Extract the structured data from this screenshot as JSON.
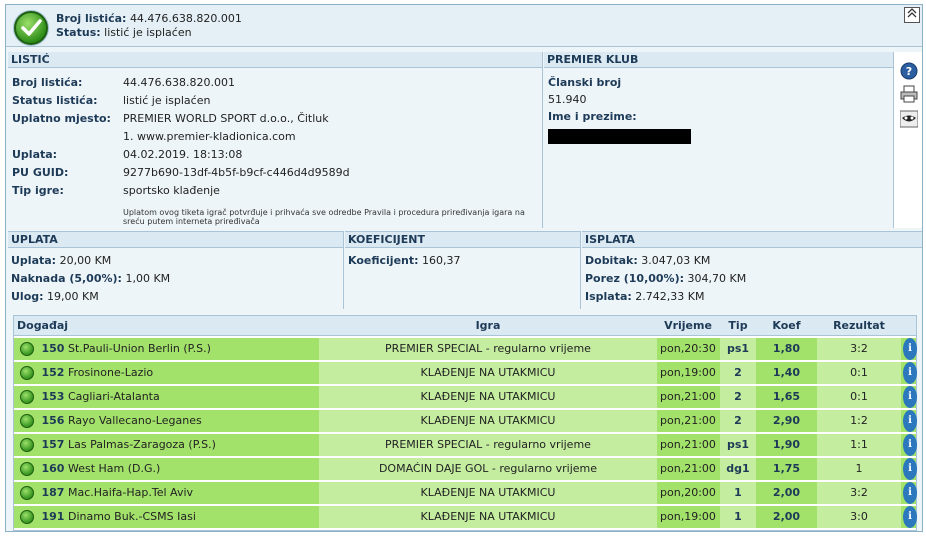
{
  "header": {
    "ticket_label": "Broj listića:",
    "ticket_value": "44.476.638.820.001",
    "status_label": "Status:",
    "status_value": "listić je isplaćen",
    "collapse_icon": "chevron-up-icon"
  },
  "listic": {
    "title": "LISTIĆ",
    "rows": [
      {
        "label": "Broj listića:",
        "value": "44.476.638.820.001"
      },
      {
        "label": "Status listića:",
        "value": "listić je isplaćen"
      },
      {
        "label": "Uplatno mjesto:",
        "value": "PREMIER WORLD SPORT d.o.o., Čitluk",
        "value2": "1. www.premier-kladionica.com"
      },
      {
        "label": "Uplata:",
        "value": "04.02.2019. 18:13:08"
      },
      {
        "label": "PU GUID:",
        "value": "9277b690-13df-4b5f-b9cf-c446d4d9589d"
      },
      {
        "label": "Tip igre:",
        "value": "sportsko klađenje"
      }
    ],
    "note": "Uplatom ovog tiketa igrač potvrđuje i prihvaća sve odredbe Pravila i procedura priređivanja igara na sreću putem interneta priređivača"
  },
  "premier": {
    "title": "PREMIER KLUB",
    "member_label": "Članski broj",
    "member_value": "51.940",
    "name_label": "Ime i prezime:"
  },
  "tools": [
    "help-icon",
    "print-icon",
    "mask-icon"
  ],
  "uplata": {
    "title": "UPLATA",
    "uplata_label": "Uplata:",
    "uplata_value": "20,00 KM",
    "naknada_label": "Naknada (5,00%):",
    "naknada_value": "1,00 KM",
    "ulog_label": "Ulog:",
    "ulog_value": "19,00 KM"
  },
  "koeficijent": {
    "title": "KOEFICIJENT",
    "label": "Koeficijent:",
    "value": "160,37"
  },
  "isplata": {
    "title": "ISPLATA",
    "dobitak_label": "Dobitak:",
    "dobitak_value": "3.047,03 KM",
    "porez_label": "Porez (10,00%):",
    "porez_value": "304,70 KM",
    "isplata_label": "Isplata:",
    "isplata_value": "2.742,33 KM"
  },
  "events": {
    "headers": {
      "dogadaj": "Događaj",
      "igra": "Igra",
      "vrijeme": "Vrijeme",
      "tip": "Tip",
      "koef": "Koef",
      "rezultat": "Rezultat"
    },
    "rows": [
      {
        "num": "150",
        "match": "St.Pauli-Union Berlin (P.S.)",
        "bet": "PREMIER SPECIAL - regularno vrijeme",
        "time": "pon,20:30",
        "tip": "ps1",
        "koef": "1,80",
        "result": "3:2"
      },
      {
        "num": "152",
        "match": "Frosinone-Lazio",
        "bet": "KLAĐENJE NA UTAKMICU",
        "time": "pon,19:00",
        "tip": "2",
        "koef": "1,40",
        "result": "0:1"
      },
      {
        "num": "153",
        "match": "Cagliari-Atalanta",
        "bet": "KLAĐENJE NA UTAKMICU",
        "time": "pon,21:00",
        "tip": "2",
        "koef": "1,65",
        "result": "0:1"
      },
      {
        "num": "156",
        "match": "Rayo Vallecano-Leganes",
        "bet": "KLAĐENJE NA UTAKMICU",
        "time": "pon,21:00",
        "tip": "2",
        "koef": "2,90",
        "result": "1:2"
      },
      {
        "num": "157",
        "match": "Las Palmas-Zaragoza (P.S.)",
        "bet": "PREMIER SPECIAL - regularno vrijeme",
        "time": "pon,21:00",
        "tip": "ps1",
        "koef": "1,90",
        "result": "1:1"
      },
      {
        "num": "160",
        "match": "West Ham (D.G.)",
        "bet": "DOMAĆIN DAJE GOL - regularno vrijeme",
        "time": "pon,21:00",
        "tip": "dg1",
        "koef": "1,75",
        "result": "1"
      },
      {
        "num": "187",
        "match": "Mac.Haifa-Hap.Tel Aviv",
        "bet": "KLAĐENJE NA UTAKMICU",
        "time": "pon,20:00",
        "tip": "1",
        "koef": "2,00",
        "result": "3:2"
      },
      {
        "num": "191",
        "match": "Dinamo Buk.-CSMS Iasi",
        "bet": "KLAĐENJE NA UTAKMICU",
        "time": "pon,19:00",
        "tip": "1",
        "koef": "2,00",
        "result": "3:0"
      }
    ]
  }
}
